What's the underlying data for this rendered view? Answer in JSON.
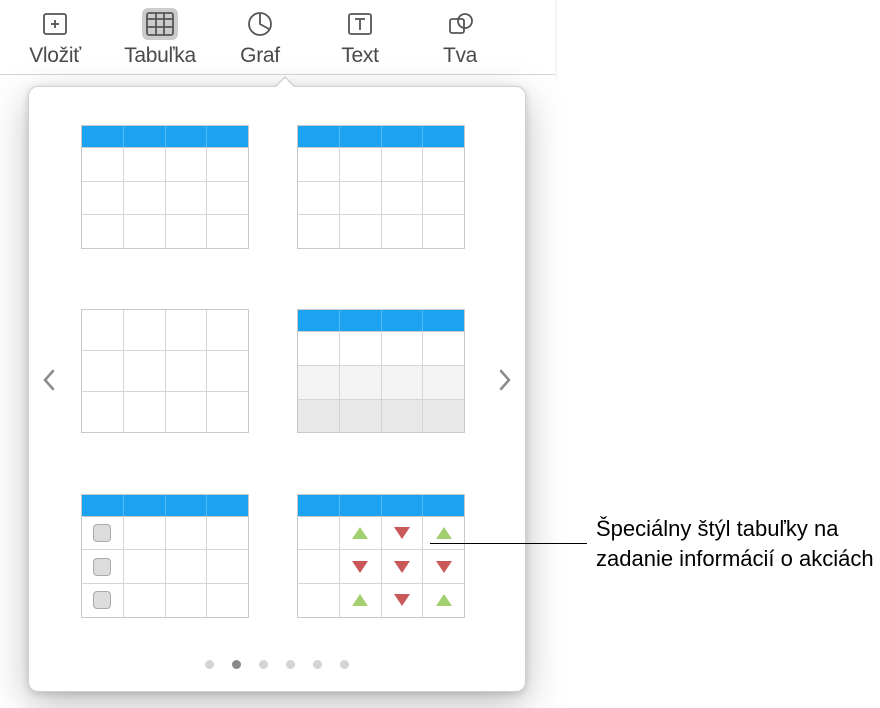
{
  "toolbar": {
    "items": [
      {
        "id": "insert",
        "label": "Vložiť"
      },
      {
        "id": "table",
        "label": "Tabuľka",
        "active": true
      },
      {
        "id": "chart",
        "label": "Graf"
      },
      {
        "id": "text",
        "label": "Text"
      },
      {
        "id": "shape",
        "label": "Tva"
      }
    ]
  },
  "popover": {
    "pages": 6,
    "active_page": 2,
    "styles": [
      {
        "id": "style-1",
        "header": true,
        "cols": 4,
        "rows": 3
      },
      {
        "id": "style-2",
        "header": true,
        "cols": 4,
        "rows": 3
      },
      {
        "id": "style-3",
        "header": false,
        "cols": 4,
        "rows": 3
      },
      {
        "id": "style-4",
        "header": true,
        "cols": 4,
        "rows": 3,
        "footer": true,
        "alt": true
      },
      {
        "id": "style-5",
        "header": true,
        "cols": 4,
        "rows": 3,
        "checks": true
      },
      {
        "id": "style-6",
        "header": true,
        "cols": 4,
        "rows": 3,
        "stocks": true
      }
    ]
  },
  "callout": {
    "text": "Špeciálny štýl tabuľky na zadanie informácií o akciách"
  },
  "icons": {
    "insert": "insert-icon",
    "table": "table-icon",
    "chart": "chart-icon",
    "text": "text-icon",
    "shape": "shape-icon"
  }
}
